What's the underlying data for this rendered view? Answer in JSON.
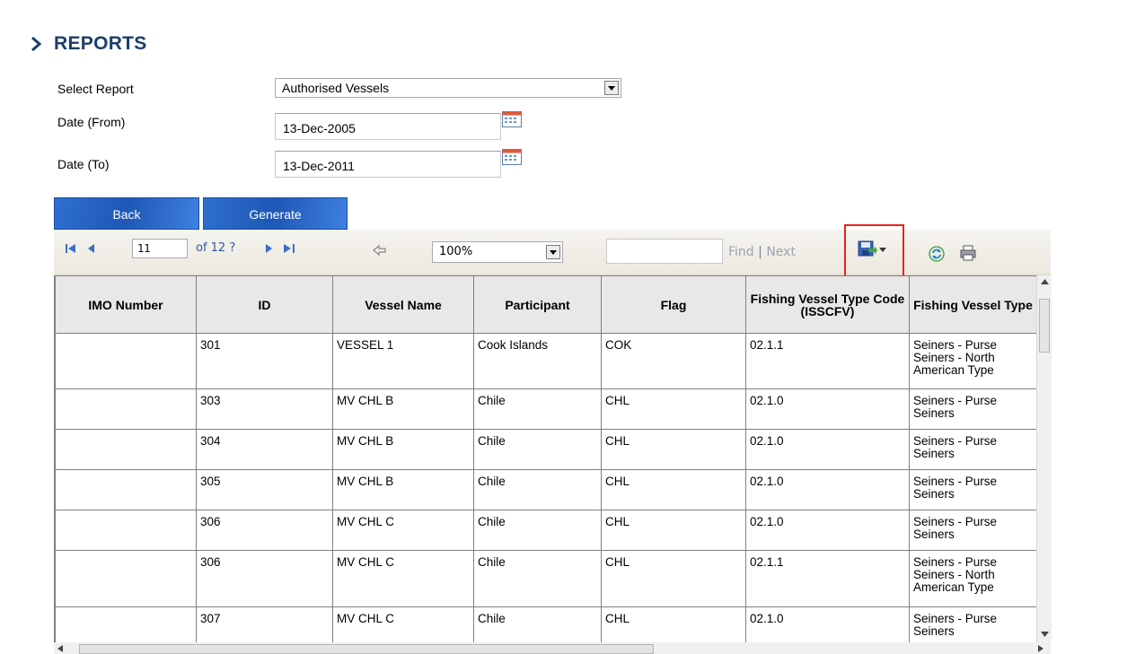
{
  "page": {
    "title": "REPORTS"
  },
  "form": {
    "select_report_label": "Select Report",
    "select_report_value": "Authorised Vessels",
    "date_from_label": "Date (From)",
    "date_from_value": "13-Dec-2005",
    "date_to_label": "Date (To)",
    "date_to_value": "13-Dec-2011"
  },
  "buttons": {
    "back": "Back",
    "generate": "Generate"
  },
  "toolbar": {
    "current_page": "11",
    "page_total": "of 12 ?",
    "zoom": "100%",
    "find_label": "Find",
    "find_sep": "|",
    "next_label": "Next",
    "highlight_color": "#e8211c"
  },
  "table": {
    "columns": [
      "IMO Number",
      "ID",
      "Vessel Name",
      "Participant",
      "Flag",
      "Fishing Vessel Type Code (ISSCFV)",
      "Fishing Vessel Type"
    ],
    "rows": [
      [
        "",
        "301",
        "VESSEL 1",
        "Cook Islands",
        "COK",
        "02.1.1",
        "Seiners - Purse Seiners - North American Type"
      ],
      [
        "",
        "303",
        "MV CHL B",
        "Chile",
        "CHL",
        "02.1.0",
        "Seiners - Purse Seiners"
      ],
      [
        "",
        "304",
        "MV CHL B",
        "Chile",
        "CHL",
        "02.1.0",
        "Seiners - Purse Seiners"
      ],
      [
        "",
        "305",
        "MV CHL B",
        "Chile",
        "CHL",
        "02.1.0",
        "Seiners - Purse Seiners"
      ],
      [
        "",
        "306",
        "MV CHL C",
        "Chile",
        "CHL",
        "02.1.0",
        "Seiners - Purse Seiners"
      ],
      [
        "",
        "306",
        "MV CHL C",
        "Chile",
        "CHL",
        "02.1.1",
        "Seiners - Purse Seiners - North American Type"
      ],
      [
        "",
        "307",
        "MV CHL C",
        "Chile",
        "CHL",
        "02.1.0",
        "Seiners - Purse Seiners"
      ]
    ]
  }
}
